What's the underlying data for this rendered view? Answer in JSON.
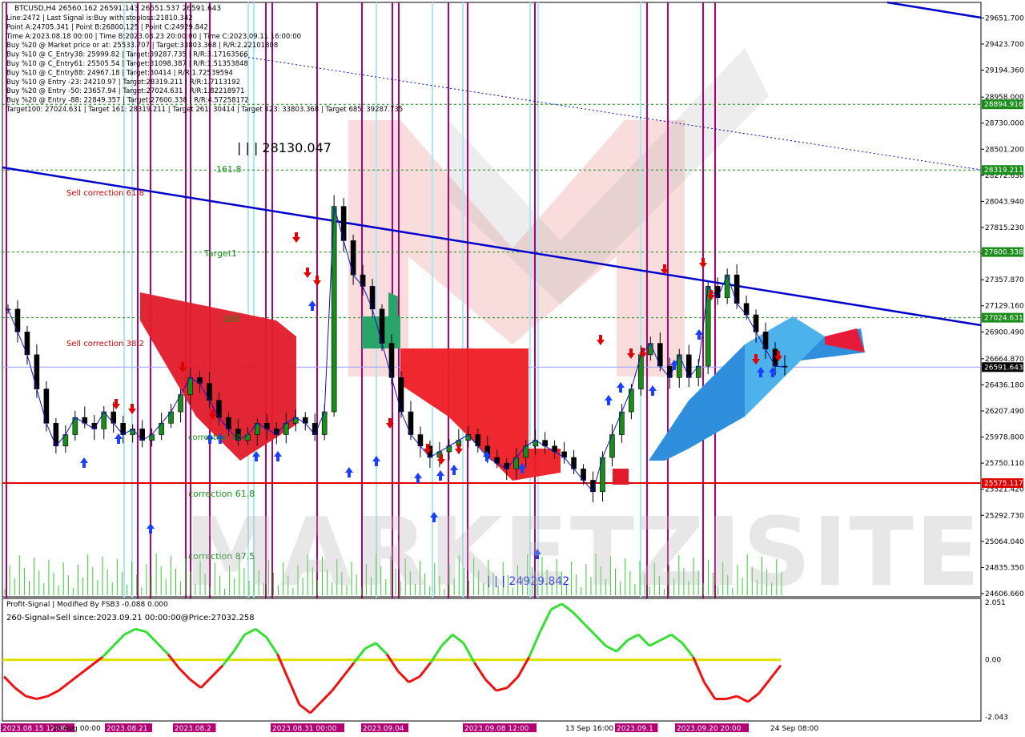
{
  "header": {
    "symbol_line": "BTCUSD,H4  26560.162 26591.143 26551.537 26591.643",
    "info_lines": [
      "Line:2472 | Last Signal is:Buy with stoploss:21810.342",
      "Point A:24705.341 | Point B:26800.125 | Point C:24929.842",
      "Time A:2023.08.18 00:00 | Time B:2023.08.23 20:00:00 | Time C:2023.09.11 16:00:00",
      "Buy %20 @ Market price or at: 25533.707 | Target:33803.368 | R/R:2.22101808",
      "Buy %10 @ C_Entry38: 25999.82 | Target:39287.735 | R/R:3.17163566",
      "Buy %10 @ C_Entry61: 25505.54 | Target:31098.387 | R/R:1.51353848",
      "Buy %10 @ C_Entry88: 24967.18 | Target:30414 | R/R:1.72539594",
      "Buy %10 @ Entry -23: 24210.97 | Target:28319.211 | R/R:1.7113192",
      "Buy %20 @ Entry -50: 23657.94 | Target:27024.631 | R/R:1.82218971",
      "Buy %20 @ Entry -88: 22849.357 | Target:27600.338 | R/R:4.57258172",
      "Target100: 27024.631 | Target 161: 28319.211 | Target 261: 30414 | Target 423: 33803.368 | Target 685: 39287.735"
    ]
  },
  "chart_data": [
    {
      "type": "candlestick",
      "title": "BTCUSD,H4",
      "ylim": [
        24606.66,
        29760
      ],
      "y_ticks": [
        "29651.700",
        "29423.700",
        "29194.360",
        "28958.000",
        "28730.000",
        "28501.200",
        "28272.630",
        "28043.940",
        "27815.230",
        "27586.000",
        "27357.870",
        "27129.160",
        "26900.490",
        "26664.870",
        "26436.180",
        "26207.490",
        "25978.800",
        "25750.110",
        "25521.420",
        "25292.730",
        "25064.040",
        "24835.350",
        "24606.660"
      ],
      "x_labels": [
        "2023.08.15 12:00",
        "18 Aug 00:00",
        "2023.08.21",
        "2023.08.2",
        "2023.08.31 00:00",
        "2023.09.04",
        "2023.09.08 12:00",
        "13 Sep 16:00",
        "2023.09.1",
        "2023.09.20 20:00",
        "24 Sep 08:00"
      ],
      "price_tags": [
        {
          "label": "28894.916",
          "value": 28894.916,
          "color": "#1a8c1a"
        },
        {
          "label": "28319.211",
          "value": 28319.211,
          "color": "#1a8c1a"
        },
        {
          "label": "27600.338",
          "value": 27600.338,
          "color": "#1a8c1a"
        },
        {
          "label": "27024.631",
          "value": 27024.631,
          "color": "#1a8c1a"
        },
        {
          "label": "26591.643",
          "value": 26591.643,
          "color": "#000000"
        },
        {
          "label": "25575.117",
          "value": 25575.117,
          "color": "#e00000"
        }
      ],
      "annotations": [
        {
          "text": "| | | 28130.047",
          "color": "#000000"
        },
        {
          "text": "161.8",
          "color": "#1a8c1a"
        },
        {
          "text": "Sell correction 61.8",
          "color": "#cc0000"
        },
        {
          "text": "Target1",
          "color": "#1a8c1a"
        },
        {
          "text": "100",
          "color": "#1a8c1a"
        },
        {
          "text": "Sell correction 38.2",
          "color": "#cc0000"
        },
        {
          "text": "correction 38.2",
          "color": "#1a8c1a"
        },
        {
          "text": "correction 61.8",
          "color": "#1a8c1a"
        },
        {
          "text": "correction 87.5",
          "color": "#1a8c1a"
        },
        {
          "text": "| | | 24929.842",
          "color": "#1a1aff"
        }
      ],
      "close_series": [
        27100,
        26900,
        26700,
        26400,
        26100,
        25900,
        26000,
        26150,
        26100,
        26050,
        26200,
        26100,
        26000,
        26050,
        25950,
        26000,
        26100,
        26200,
        26350,
        26500,
        26450,
        26300,
        26150,
        26050,
        25950,
        26000,
        26100,
        26050,
        26000,
        26100,
        26150,
        26100,
        26000,
        26200,
        28000,
        27700,
        27400,
        27300,
        27100,
        26800,
        26500,
        26200,
        26000,
        25900,
        25800,
        25850,
        25900,
        25950,
        26000,
        25900,
        25800,
        25750,
        25700,
        25800,
        25900,
        25950,
        25900,
        25850,
        25800,
        25700,
        25600,
        25500,
        25800,
        26000,
        26200,
        26400,
        26700,
        26800,
        26600,
        26500,
        26700,
        26500,
        26600,
        27300,
        27200,
        27400,
        27150,
        27050,
        26900,
        26750,
        26600,
        26591.643
      ],
      "colors": {
        "bull": "#1a8c1a",
        "bear": "#000000",
        "trendline": "#0000cc",
        "resistance": "#e00000",
        "grid": "#e6e6e6"
      }
    },
    {
      "type": "line",
      "title": "Profit-Signal | Modified By FSB3 -0.088 0.000",
      "subtitle": "260-Signal=Sell since:2023.09.21 00:00:00@Price:27032.258",
      "ylim": [
        -2.043,
        2.051
      ],
      "y_ticks": [
        "2.051",
        "0.00",
        "-2.043"
      ],
      "zero_line_color": "#e0e000",
      "series": [
        {
          "name": "",
          "values": [
            -0.6,
            -1.0,
            -1.3,
            -1.4,
            -1.3,
            -1.1,
            -0.8,
            -0.5,
            -0.2,
            0.1,
            0.5,
            0.9,
            1.1,
            1.0,
            0.6,
            0.2,
            -0.3,
            -0.7,
            -1.0,
            -0.6,
            -0.2,
            0.3,
            0.9,
            1.1,
            0.8,
            0.2,
            -0.7,
            -1.6,
            -1.9,
            -1.5,
            -1.1,
            -0.6,
            -0.1,
            0.4,
            0.6,
            0.2,
            -0.4,
            -0.8,
            -0.6,
            -0.1,
            0.5,
            0.9,
            0.6,
            -0.1,
            -0.7,
            -1.1,
            -1.0,
            -0.6,
            0.1,
            1.0,
            1.8,
            2.0,
            1.7,
            1.3,
            0.9,
            0.5,
            0.3,
            0.7,
            0.9,
            0.5,
            0.7,
            0.9,
            0.6,
            0.1,
            -0.8,
            -1.4,
            -1.4,
            -1.3,
            -1.5,
            -1.2,
            -0.7,
            -0.2
          ]
        }
      ]
    }
  ],
  "watermark": "MARKETZISITE"
}
